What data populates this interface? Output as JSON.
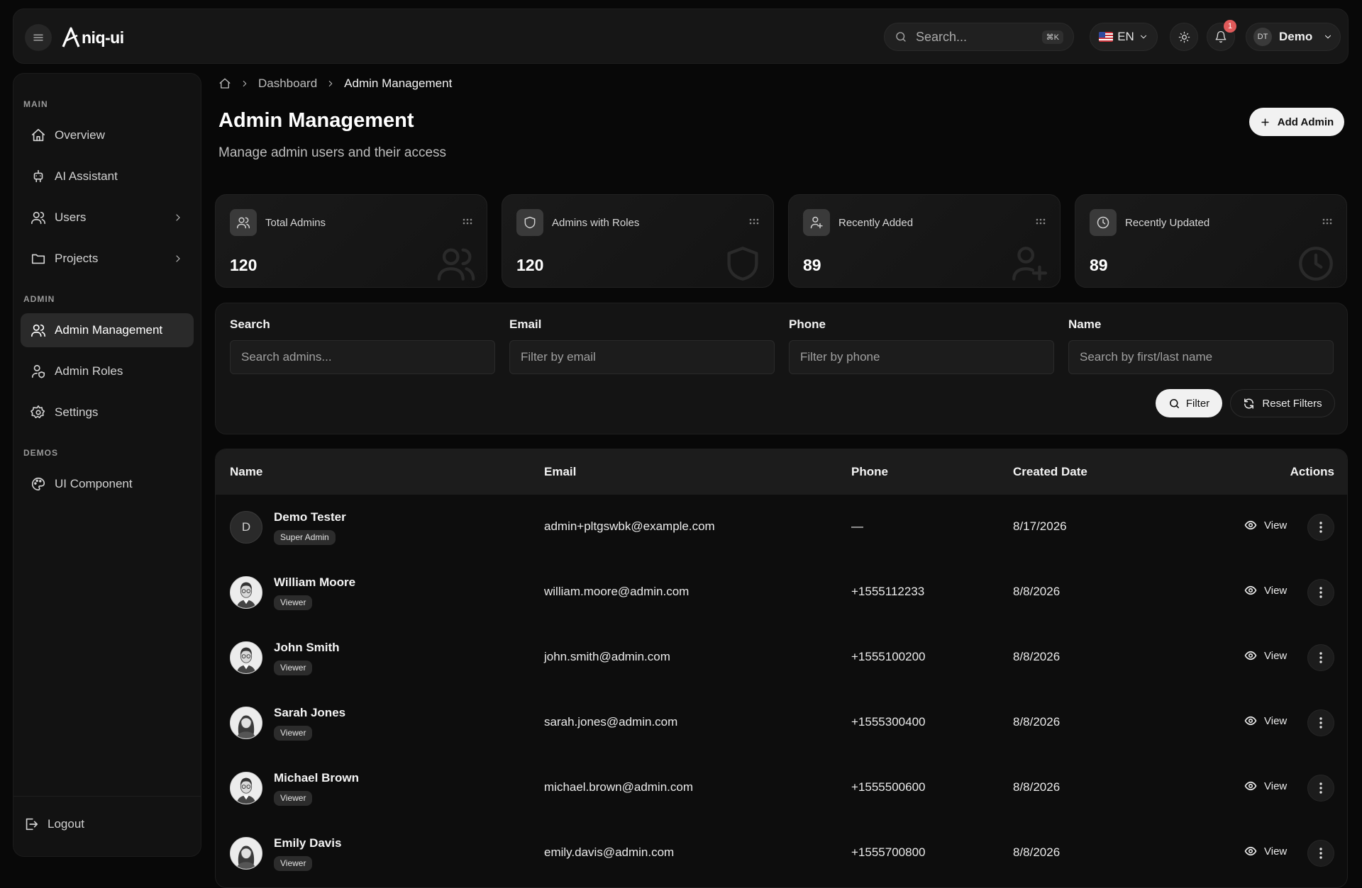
{
  "app": {
    "logo_text": "niq-ui"
  },
  "topbar": {
    "search_placeholder": "Search...",
    "search_shortcut": "⌘K",
    "language": "EN",
    "notification_count": "1",
    "user_initials": "DT",
    "user_name": "Demo"
  },
  "sidebar": {
    "sections": [
      {
        "label": "MAIN"
      },
      {
        "label": "ADMIN"
      },
      {
        "label": "DEMOS"
      }
    ],
    "items": [
      {
        "label": "Overview",
        "icon": "home-icon"
      },
      {
        "label": "AI Assistant",
        "icon": "robot-icon"
      },
      {
        "label": "Users",
        "icon": "users-icon",
        "has_submenu": true
      },
      {
        "label": "Projects",
        "icon": "folder-icon",
        "has_submenu": true
      },
      {
        "label": "Admin Management",
        "icon": "users-icon",
        "active": true
      },
      {
        "label": "Admin Roles",
        "icon": "user-shield-icon"
      },
      {
        "label": "Settings",
        "icon": "gear-icon"
      },
      {
        "label": "UI Component",
        "icon": "palette-icon"
      }
    ],
    "logout_label": "Logout"
  },
  "breadcrumb": {
    "items": [
      "Dashboard",
      "Admin Management"
    ]
  },
  "page": {
    "title": "Admin Management",
    "subtitle": "Manage admin users and their access",
    "add_button": "Add Admin"
  },
  "stats": [
    {
      "label": "Total Admins",
      "value": "120",
      "icon": "users-icon"
    },
    {
      "label": "Admins with Roles",
      "value": "120",
      "icon": "shield-icon"
    },
    {
      "label": "Recently Added",
      "value": "89",
      "icon": "user-plus-icon"
    },
    {
      "label": "Recently Updated",
      "value": "89",
      "icon": "clock-icon"
    }
  ],
  "filters": {
    "fields": [
      {
        "label": "Search",
        "placeholder": "Search admins..."
      },
      {
        "label": "Email",
        "placeholder": "Filter by email"
      },
      {
        "label": "Phone",
        "placeholder": "Filter by phone"
      },
      {
        "label": "Name",
        "placeholder": "Search by first/last name"
      }
    ],
    "filter_button": "Filter",
    "reset_button": "Reset Filters"
  },
  "table": {
    "columns": [
      "Name",
      "Email",
      "Phone",
      "Created Date",
      "Actions"
    ],
    "view_label": "View",
    "rows": [
      {
        "initial": "D",
        "name": "Demo Tester",
        "role": "Super Admin",
        "email": "admin+pltgswbk@example.com",
        "phone": "—",
        "created": "8/17/2026",
        "avatar": "initial"
      },
      {
        "initial": "",
        "name": "William Moore",
        "role": "Viewer",
        "email": "william.moore@admin.com",
        "phone": "+1555112233",
        "created": "8/8/2026",
        "avatar": "male"
      },
      {
        "initial": "",
        "name": "John Smith",
        "role": "Viewer",
        "email": "john.smith@admin.com",
        "phone": "+1555100200",
        "created": "8/8/2026",
        "avatar": "male"
      },
      {
        "initial": "",
        "name": "Sarah Jones",
        "role": "Viewer",
        "email": "sarah.jones@admin.com",
        "phone": "+1555300400",
        "created": "8/8/2026",
        "avatar": "female"
      },
      {
        "initial": "",
        "name": "Michael Brown",
        "role": "Viewer",
        "email": "michael.brown@admin.com",
        "phone": "+1555500600",
        "created": "8/8/2026",
        "avatar": "male"
      },
      {
        "initial": "",
        "name": "Emily Davis",
        "role": "Viewer",
        "email": "emily.davis@admin.com",
        "phone": "+1555700800",
        "created": "8/8/2026",
        "avatar": "female"
      }
    ]
  },
  "colors": {
    "background": "#080808",
    "surface": "#141414",
    "accent_button": "#f1f1f1",
    "notification_badge": "#e05a5a"
  }
}
